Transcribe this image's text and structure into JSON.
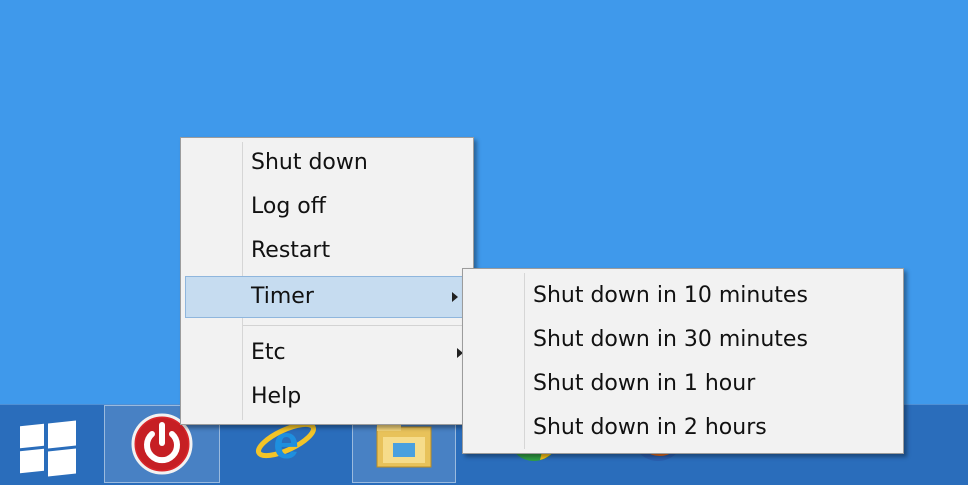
{
  "main_menu": {
    "items": [
      {
        "label": "Shut down"
      },
      {
        "label": "Log off"
      },
      {
        "label": "Restart"
      },
      {
        "label": "Timer"
      },
      {
        "label": "Etc"
      },
      {
        "label": "Help"
      }
    ]
  },
  "timer_submenu": {
    "items": [
      {
        "label": "Shut down in 10 minutes"
      },
      {
        "label": "Shut down in 30 minutes"
      },
      {
        "label": "Shut down in 1 hour"
      },
      {
        "label": "Shut down in 2 hours"
      }
    ]
  },
  "taskbar": {
    "items": [
      {
        "icon": "windows-logo-icon"
      },
      {
        "icon": "power-icon"
      },
      {
        "icon": "internet-explorer-icon"
      },
      {
        "icon": "file-explorer-icon"
      },
      {
        "icon": "chrome-icon"
      },
      {
        "icon": "firefox-icon"
      }
    ]
  },
  "colors": {
    "desktop": "#3f99eb",
    "taskbar": "#2a6dbb",
    "menu_bg": "#f2f2f2",
    "hover": "#c6dcf0",
    "power_red": "#d9262b"
  }
}
